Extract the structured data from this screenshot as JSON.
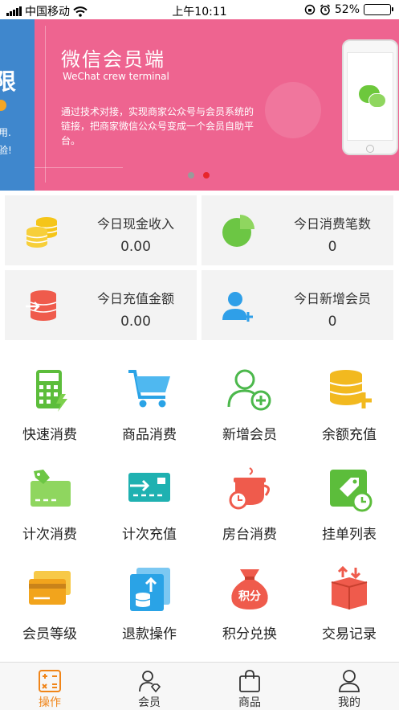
{
  "status_bar": {
    "carrier": "中国移动",
    "time": "上午10:11",
    "battery": "52%",
    "battery_level": 0.52
  },
  "banner": {
    "title": "微信会员端",
    "subtitle": "WeChat crew terminal",
    "description": "通过技术对接，实现商家公众号与会员系统的链接，把商家微信公众号变成一个会员自助平台。",
    "prev_slide_big": "限",
    "prev_slide_line1": "用.",
    "prev_slide_line2": "验!",
    "active_slide": 2,
    "slide_count": 2
  },
  "stats": [
    {
      "label": "今日现金收入",
      "value": "0.00",
      "icon": "coins-icon",
      "color": "#f5c518"
    },
    {
      "label": "今日消费笔数",
      "value": "0",
      "icon": "pie-chart-icon",
      "color": "#6cc644"
    },
    {
      "label": "今日充值金额",
      "value": "0.00",
      "icon": "database-arrow-icon",
      "color": "#ef5b4c"
    },
    {
      "label": "今日新增会员",
      "value": "0",
      "icon": "add-user-icon",
      "color": "#2f9fe8"
    }
  ],
  "grid": [
    {
      "label": "快速消费",
      "icon": "calculator-icon",
      "color": "#5cbd3b"
    },
    {
      "label": "商品消费",
      "icon": "cart-icon",
      "color": "#2aa3e6"
    },
    {
      "label": "新增会员",
      "icon": "add-user-icon",
      "color": "#4cb84c"
    },
    {
      "label": "余额充值",
      "icon": "coin-stack-plus-icon",
      "color": "#f2b91f"
    },
    {
      "label": "计次消费",
      "icon": "card-tag-icon",
      "color": "#7cc742"
    },
    {
      "label": "计次充值",
      "icon": "card-arrow-icon",
      "color": "#1fb1b1"
    },
    {
      "label": "房台消费",
      "icon": "teacup-clock-icon",
      "color": "#ef5b4c"
    },
    {
      "label": "挂单列表",
      "icon": "tag-clock-icon",
      "color": "#5cbd3b"
    },
    {
      "label": "会员等级",
      "icon": "cards-icon",
      "color": "#f2a41c"
    },
    {
      "label": "退款操作",
      "icon": "refund-database-icon",
      "color": "#2aa3e6"
    },
    {
      "label": "积分兑换",
      "icon": "points-bag-icon",
      "color": "#ef5b4c"
    },
    {
      "label": "交易记录",
      "icon": "box-arrows-icon",
      "color": "#ef5b4c"
    }
  ],
  "grid_points_text": "积分",
  "tabs": [
    {
      "label": "操作",
      "icon": "calculator-icon",
      "active": true
    },
    {
      "label": "会员",
      "icon": "member-icon",
      "active": false
    },
    {
      "label": "商品",
      "icon": "shopping-bag-icon",
      "active": false
    },
    {
      "label": "我的",
      "icon": "person-icon",
      "active": false
    }
  ],
  "colors": {
    "banner_bg": "#ee6490",
    "banner_prev_bg": "#3f87cd",
    "active_tab": "#f08519",
    "card_bg": "#f3f3f3"
  }
}
